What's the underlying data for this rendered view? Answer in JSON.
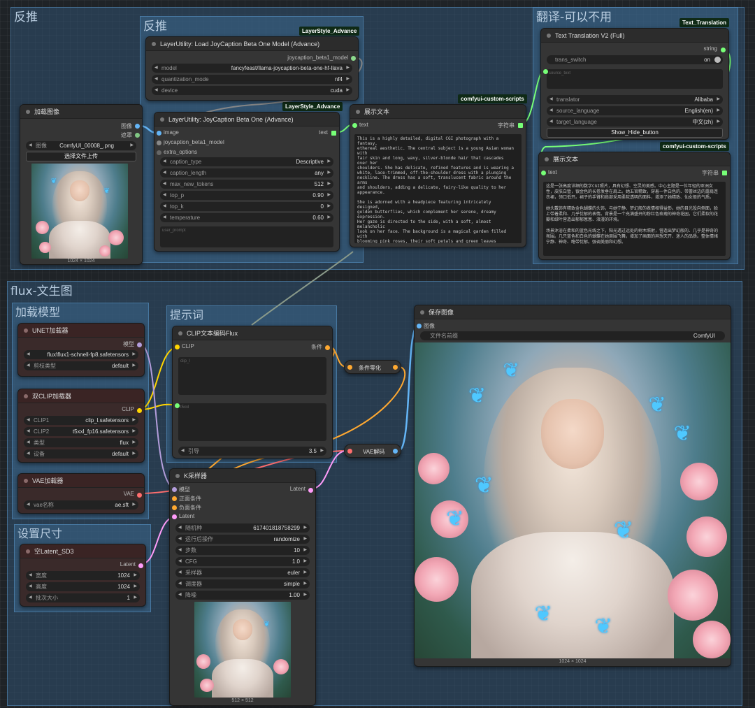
{
  "groups": {
    "g1": "反推",
    "g2": "反推",
    "g3": "翻译-可以不用",
    "g4": "flux-文生图",
    "g5": "加载模型",
    "g6": "提示词",
    "g7": "设置尺寸"
  },
  "tags": {
    "t1": "LayerStyle_Advance",
    "t2": "LayerStyle_Advance",
    "t3": "comfyui-custom-scripts",
    "t4": "Text_Translation",
    "t5": "comfyui-custom-scripts"
  },
  "load_image": {
    "title": "加载图像",
    "out1": "图像",
    "out2": "遮罩",
    "image_label": "图像",
    "image_value": "ComfyUI_00008_.png",
    "upload": "选择文件上传",
    "size": "1024 × 1024"
  },
  "jc_model": {
    "title": "LayerUtility: Load JoyCaption Beta One Model (Advance)",
    "out": "joycaption_beta1_model",
    "w": [
      {
        "l": "model",
        "v": "fancyfeast/llama-joycaption-beta-one-hf-llava"
      },
      {
        "l": "quantization_mode",
        "v": "nf4"
      },
      {
        "l": "device",
        "v": "cuda"
      }
    ]
  },
  "jc": {
    "title": "LayerUtility: JoyCaption Beta One (Advance)",
    "in1": "image",
    "in2": "joycaption_beta1_model",
    "in3": "extra_options",
    "out": "text",
    "w": [
      {
        "l": "caption_type",
        "v": "Descriptive"
      },
      {
        "l": "caption_length",
        "v": "any"
      },
      {
        "l": "max_new_tokens",
        "v": "512"
      },
      {
        "l": "top_p",
        "v": "0.90"
      },
      {
        "l": "top_k",
        "v": "0"
      },
      {
        "l": "temperature",
        "v": "0.60"
      }
    ],
    "user_prompt": "user_prompt"
  },
  "show1": {
    "title": "展示文本",
    "in": "text",
    "out": "字符串",
    "text": "This is a highly detailed, digital CGI photograph with a fantasy,\nethereal aesthetic. The central subject is a young Asian woman with\nfair skin and long, wavy, silver-blonde hair that cascades over her\nshoulders. She has delicate, refined features and is wearing a\nwhite, lace-trimmed, off-the-shoulder dress with a plunging\nneckline. The dress has a soft, translucent fabric around the arms\nand shoulders, adding a delicate, fairy-like quality to her\nappearance.\n\nShe is adorned with a headpiece featuring intricately designed,\ngolden butterflies, which complement her serene, dreamy expression.\nHer gaze is directed to the side, with a soft, almost melancholic\nlook on her face. The background is a magical garden filled with\nblooming pink roses, their soft petals and green leaves creating a\nlush, romantic setting.\n\nThe scene is bathed in a soft, bluish light, with sunlight\nfiltering through the trees in the distance, creating a dreamy,\nalmost magical atmosphere. Several blue and white butterflies are\nfluttering around her, adding to the whimsical, enchanting quality\nof the image. The overall mood is serene, magical, and slightly"
  },
  "trans": {
    "title": "Text Translation V2 (Full)",
    "out": "string",
    "switch_label": "trans_switch",
    "switch_value": "on",
    "source_text": "source_text",
    "w": [
      {
        "l": "translator",
        "v": "Alibaba"
      },
      {
        "l": "source_language",
        "v": "English(en)"
      },
      {
        "l": "target_language",
        "v": "中文(zh)"
      }
    ],
    "button": "Show_Hide_button"
  },
  "show2": {
    "title": "展示文本",
    "in": "text",
    "out": "字符串",
    "text": "这是一张高度详细的数字CGI照片，具有幻想、空灵的美感。中心主题是一位年轻的亚洲女性，皮肤白皙，银金色的长卷发垂在肩上。她五官精致，穿着一件白色的、带蕾丝边的露肩连衣裙，领口低开。裙子的手臂和肩部采用柔软透明的面料，增添了她精致、仙女般的气质。\n\n她头戴饰有精致金色蝴蝶的头饰，与她宁静、梦幻般的表情相得益彰。她的目光投向侧面，脸上带着柔和、几乎忧郁的表情。背景是一个充满盛开的粉红色玫瑰的神奇花园，它们柔软的花瓣和绿叶营造出郁郁葱葱、浪漫的环境。\n\n场景沐浴在柔和的蓝色光线之下，阳光透过远处的树木照射，营造出梦幻般的、几乎是神奇的氛围。几只蓝色和白色的蝴蝶在她周围飞舞，增加了画面的异想天开、迷人的品质。整体情绪宁静、神奇、略带忧郁。强调美丽和幻想。"
  },
  "unet": {
    "title": "UNET加载器",
    "out": "模型",
    "w": [
      {
        "l": "",
        "v": "flux\\flux1-schnell-fp8.safetensors"
      },
      {
        "l": "剪枝类型",
        "v": "default"
      }
    ]
  },
  "dclip": {
    "title": "双CLIP加载器",
    "out": "CLIP",
    "w": [
      {
        "l": "CLIP1",
        "v": "clip_l.safetensors"
      },
      {
        "l": "CLIP2",
        "v": "t5xxl_fp16.safetensors"
      },
      {
        "l": "类型",
        "v": "flux"
      },
      {
        "l": "设备",
        "v": "default"
      }
    ]
  },
  "vae": {
    "title": "VAE加载器",
    "out": "VAE",
    "w": [
      {
        "l": "vae名称",
        "v": "ae.sft"
      }
    ]
  },
  "latent": {
    "title": "空Latent_SD3",
    "out": "Latent",
    "w": [
      {
        "l": "宽度",
        "v": "1024"
      },
      {
        "l": "高度",
        "v": "1024"
      },
      {
        "l": "批次大小",
        "v": "1"
      }
    ]
  },
  "clipenc": {
    "title": "CLIP文本编码Flux",
    "in": "CLIP",
    "out": "条件",
    "clip_l": "clip_l",
    "t5xxl": "t5xxl",
    "w": [
      {
        "l": "引导",
        "v": "3.5"
      }
    ]
  },
  "zero": {
    "title": "条件零化"
  },
  "vaedec": {
    "title": "VAE解码"
  },
  "ksampler": {
    "title": "K采样器",
    "in1": "模型",
    "in2": "正面条件",
    "in3": "负面条件",
    "in4": "Latent",
    "out": "Latent",
    "w": [
      {
        "l": "随机种",
        "v": "617401818758299"
      },
      {
        "l": "运行后操作",
        "v": "randomize"
      },
      {
        "l": "步数",
        "v": "10"
      },
      {
        "l": "CFG",
        "v": "1.0"
      },
      {
        "l": "采样器",
        "v": "euler"
      },
      {
        "l": "调度器",
        "v": "simple"
      },
      {
        "l": "降噪",
        "v": "1.00"
      }
    ],
    "size": "512 × 512"
  },
  "save": {
    "title": "保存图像",
    "in": "图像",
    "prefix_label": "文件名前缀",
    "prefix_value": "ComfyUI",
    "size": "1024 × 1024"
  },
  "colors": {
    "image": "#64b5f6",
    "mask": "#81c784",
    "model": "#b39ddb",
    "clip": "#ffd500",
    "cond": "#ffa931",
    "vae": "#ff6e6e",
    "latent": "#ff9cf9",
    "string": "#77ff77"
  }
}
